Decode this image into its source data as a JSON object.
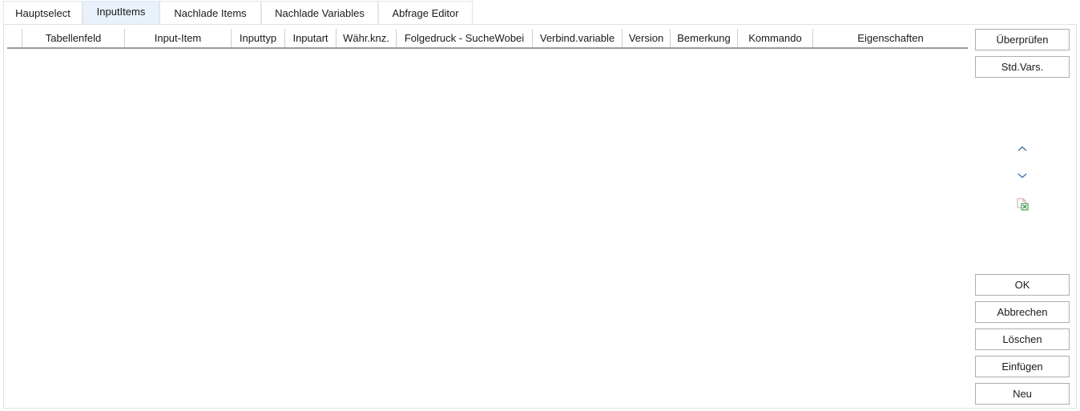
{
  "tabs": [
    {
      "label": "Hauptselect",
      "active": false
    },
    {
      "label": "InputItems",
      "active": true
    },
    {
      "label": "Nachlade Items",
      "active": false
    },
    {
      "label": "Nachlade Variables",
      "active": false
    },
    {
      "label": "Abfrage Editor",
      "active": false
    }
  ],
  "grid": {
    "columns": [
      "",
      "Tabellenfeld",
      "Input-Item",
      "Inputtyp",
      "Inputart",
      "Währ.knz.",
      "Folgedruck - SucheWobei",
      "Verbind.variable",
      "Version",
      "Bemerkung",
      "Kommando",
      "Eigenschaften"
    ],
    "rows": []
  },
  "buttons": {
    "check": "Überprüfen",
    "std_vars": "Std.Vars.",
    "ok": "OK",
    "cancel": "Abbrechen",
    "delete": "Löschen",
    "insert": "Einfügen",
    "new": "Neu"
  },
  "icons": {
    "move_up": "chevron-up-icon",
    "move_down": "chevron-down-icon",
    "excel_export": "excel-export-icon"
  },
  "colors": {
    "active_tab_bg": "#e9f1fb",
    "chevron": "#3a6ea5",
    "excel_green": "#2e8b3a",
    "excel_doc": "#c9a7a7"
  }
}
